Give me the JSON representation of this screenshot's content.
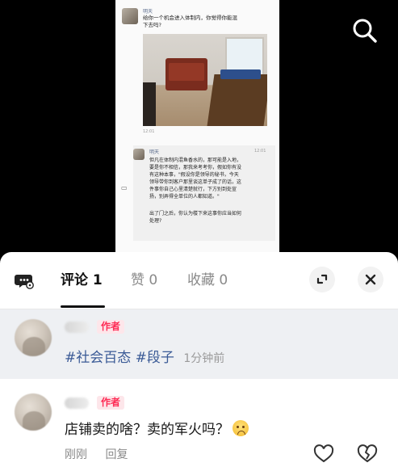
{
  "post_image": {
    "author_name": "明天",
    "text_line1": "给你一个机会进入体制内，你觉得你能混",
    "text_line2": "下去吗?",
    "time_top": "12:01",
    "quote_author": "明天",
    "quote_time": "12:01",
    "quote_lines": [
      "但凡在体制内混鱼香水的，那可能是入地，",
      "要是你不相信，那我来考考你，假如你有没",
      "有这种本事，\"假设你是领导的秘书，今天",
      "领导带你到客户那里谈这单子成了的话，这",
      "件事你自己心里清楚就行，下方别到处宣",
      "扬，别弄得全单位的人都知道。\"",
      "",
      "出了门之后，你认为楼下来这事你应当如何",
      "处理?"
    ]
  },
  "tabs": [
    {
      "label": "评论",
      "count": "1"
    },
    {
      "label": "赞",
      "count": "0"
    },
    {
      "label": "收藏",
      "count": "0"
    }
  ],
  "comments": [
    {
      "badge": "作者",
      "hashtags": [
        "#社会百态",
        "#段子"
      ],
      "time": "1分钟前"
    },
    {
      "badge": "作者",
      "text": "店铺卖的啥？卖的军火吗？",
      "time": "刚刚",
      "reply_label": "回复"
    }
  ],
  "icons": {
    "search": "search-icon",
    "chat": "chat-bubble-icon",
    "expand": "expand-icon",
    "close": "close-icon",
    "like": "heart-icon",
    "dislike": "broken-heart-icon"
  },
  "colors": {
    "accent": "#fe2c55",
    "hashtag": "#3a5a96",
    "pinned_bg": "#eef0f3"
  }
}
